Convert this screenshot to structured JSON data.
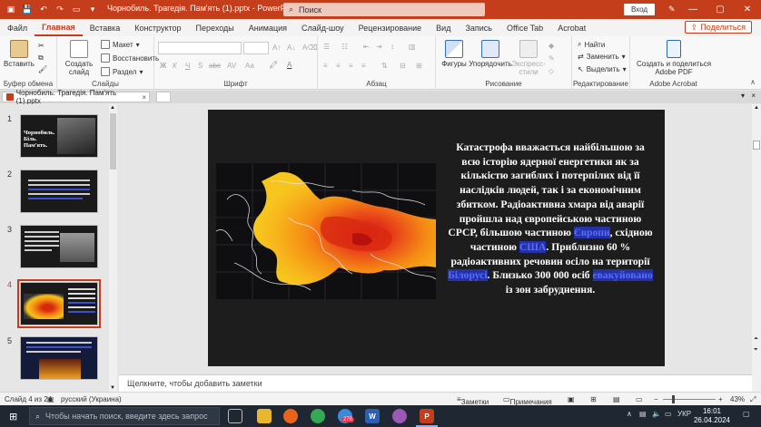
{
  "titlebar": {
    "doc_title": "Чорнобиль. Трагедія. Пам'ять (1).pptx  -  PowerPoint",
    "search_placeholder": "Поиск",
    "login_label": "Вход",
    "colors": {
      "accent": "#c43e1c"
    }
  },
  "tabs": [
    "Файл",
    "Главная",
    "Вставка",
    "Конструктор",
    "Переходы",
    "Анимация",
    "Слайд-шоу",
    "Рецензирование",
    "Вид",
    "Запись",
    "Office Tab",
    "Acrobat"
  ],
  "active_tab": "Главная",
  "share_label": "Поделиться",
  "ribbon": {
    "clipboard": {
      "paste": "Вставить",
      "group": "Буфер обмена"
    },
    "slides": {
      "new_slide": "Создать слайд",
      "layout": "Макет",
      "reset": "Восстановить",
      "section": "Раздел",
      "group": "Слайды"
    },
    "font": {
      "group": "Шрифт",
      "bold": "Ж",
      "italic": "К",
      "underline": "Ч",
      "strike": "abc",
      "shadow": "S",
      "spacing": "AV",
      "case": "Aa"
    },
    "paragraph": {
      "group": "Абзац"
    },
    "drawing": {
      "shapes": "Фигуры",
      "arrange": "Упорядочить",
      "quick_styles": "Экспресс-стили",
      "group": "Рисование"
    },
    "editing": {
      "find": "Найти",
      "replace": "Заменить",
      "select": "Выделить",
      "group": "Редактирование"
    },
    "acrobat": {
      "create_share": "Создать и поделиться Adobe PDF",
      "group": "Adobe Acrobat"
    }
  },
  "doc_tab": "Чорнобиль. Трагедія. Пам'ять (1).pptx",
  "thumbnails": [
    {
      "num": "1",
      "caption": "Чорнобиль. Біль. Пам'ять."
    },
    {
      "num": "2"
    },
    {
      "num": "3"
    },
    {
      "num": "4",
      "selected": true
    },
    {
      "num": "5"
    }
  ],
  "slide": {
    "text_before_1": "Катастрофа вважається найбільшою за всю історію ядерної енергетики як за кількістю загиблих і потерпілих від її наслідків людей, так і за економічним збитком. Радіоактивна хмара від аварії пройшла над європейською частиною СРСР, більшою частиною ",
    "link_1": "Європи",
    "text_before_2": ", східною частиною ",
    "link_2": "США",
    "text_before_3": ". Приблизно 60 % радіоактивних речовин осіло на території ",
    "link_3": "Білорусі",
    "text_before_4": ". Близько 300 000 осіб ",
    "link_4": "евакуйовано",
    "text_after": " із зон забруднення.",
    "highlight_color": "#2432a8"
  },
  "notes_placeholder": "Щелкните, чтобы добавить заметки",
  "status": {
    "slide_counter": "Слайд 4 из 24",
    "language": "русский (Украина)",
    "notes_label": "Заметки",
    "comments_label": "Примечания",
    "zoom": "43%"
  },
  "taskbar": {
    "search_placeholder": "Чтобы начать поиск, введите здесь запрос",
    "badge": "278",
    "lang": "УКР",
    "time": "16:01",
    "date": "26.04.2024"
  }
}
